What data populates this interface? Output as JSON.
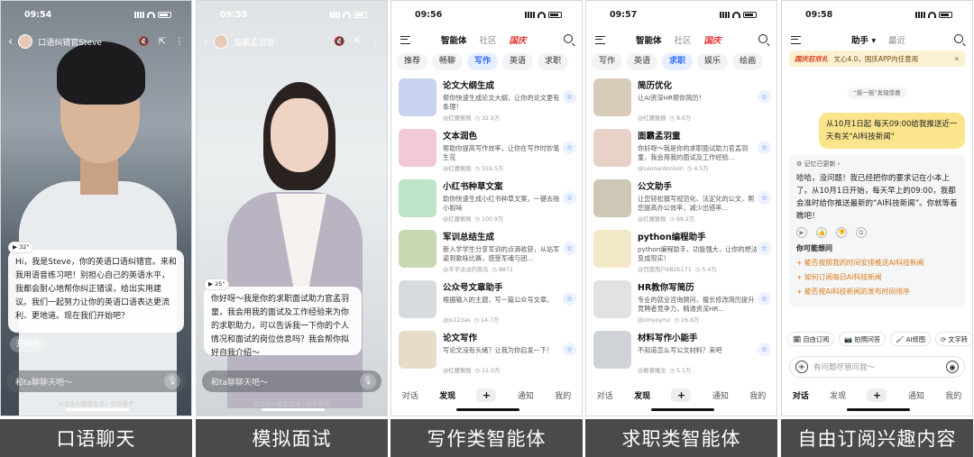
{
  "captions": [
    "口语聊天",
    "模拟面试",
    "写作类智能体",
    "求职类智能体",
    "自由订阅兴趣内容"
  ],
  "screen1": {
    "time": "09:54",
    "title": "口语纠错官Steve",
    "duration": "32\"",
    "message": "Hi，我是Steve，你的英语口语纠错官。来和我用语音练习吧！别担心自己的英语水平，我都会耐心地帮你纠正错误，给出实用建议。我们一起努力让你的英语口语表达更流利、更地道。现在我们开始吧？",
    "start_label": "开始吧",
    "input_placeholder": "和ta聊聊天吧～",
    "footnote": "对话由AI模型生成，仅供参考"
  },
  "screen2": {
    "time": "09:55",
    "title": "面霸孟羽童",
    "duration": "25\"",
    "message": "你好呀～我是你的求职面试助力官孟羽童，我会用我的面试及工作经验来为你的求职助力，可以告诉我一下你的个人情况和面试的岗位信息吗？我会帮你拟好自我介绍～",
    "input_placeholder": "和ta聊聊天吧～",
    "footnote": "对话由AI模型生成，仅供参考"
  },
  "screen3": {
    "time": "09:56",
    "nav_tabs": [
      "智能体",
      "社区",
      "国庆"
    ],
    "categories": [
      "推荐",
      "畅聊",
      "写作",
      "英语",
      "求职"
    ],
    "active_category": "写作",
    "agents": [
      {
        "name": "论文大纲生成",
        "desc": "帮你快速生成论文大纲，让你的论文更有条理！",
        "author": "@红魔猴猴",
        "count": "32.9万",
        "color": "#c7d3ef"
      },
      {
        "name": "文本润色",
        "desc": "帮助你提高写作效率，让你在写作时妙笔生花",
        "author": "@红魔猴猴",
        "count": "559.5万",
        "color": "#f2c9d9"
      },
      {
        "name": "小红书种草文案",
        "desc": "助你快速生成小红书种草文案，一键去除小姐味",
        "author": "@红魔猴猴",
        "count": "100.9万",
        "color": "#bfe3c6"
      },
      {
        "name": "军训总结生成",
        "desc": "新入学学生分享军训的点滴收获，从站军姿到歌咏比赛，感受军魂与团...",
        "author": "@平平淡淡的南瓜",
        "count": "8872",
        "color": "#c9d8b0"
      },
      {
        "name": "公众号文章助手",
        "desc": "根据输入的主题，写一篇公众号文章。",
        "author": "@js123as",
        "count": "14.7万",
        "color": "#d7dadf"
      },
      {
        "name": "论文写作",
        "desc": "写论文没有头绪？让我为你启发一下！",
        "author": "@红魔猴猴",
        "count": "11.0万",
        "color": "#e6dcc9"
      }
    ],
    "bottom_nav": [
      "对话",
      "发现",
      "+",
      "通知",
      "我的"
    ]
  },
  "screen4": {
    "time": "09:57",
    "nav_tabs": [
      "智能体",
      "社区",
      "国庆"
    ],
    "categories": [
      "写作",
      "英语",
      "求职",
      "娱乐",
      "绘画"
    ],
    "active_category": "求职",
    "agents": [
      {
        "name": "简历优化",
        "desc": "让AI资深HR帮你简历！",
        "author": "@红魔猴猴",
        "count": "8.6万",
        "color": "#d9cbb9"
      },
      {
        "name": "面霸孟羽童",
        "desc": "你好呀～我是你的求职面试助力官孟羽童，我会用我的面试及工作经验...",
        "author": "@Leonardonlxin",
        "count": "4.5万",
        "color": "#e8d2c7"
      },
      {
        "name": "公文助手",
        "desc": "让您轻松撰写规范化、法定化的公文，帮您提高办公效率，减少出错率...",
        "author": "@红魔猴猴",
        "count": "88.2万",
        "color": "#cfc7b6"
      },
      {
        "name": "python编程助手",
        "desc": "python编程助手，功能强大，让你的想法变成现实！",
        "author": "@百度用户bB2b171",
        "count": "5.4万",
        "color": "#f3e9c9"
      },
      {
        "name": "HR教你写简历",
        "desc": "专业的就业咨询顾问，擅长修改简历提升竞聘者竞争力，精通资深HR...",
        "author": "@zmyoymz",
        "count": "26.8万",
        "color": "#e2e2e2"
      },
      {
        "name": "材料写作小能手",
        "desc": "不知道怎么写公文材料？来吧",
        "author": "@靓睿庵文",
        "count": "5.1万",
        "color": "#cfd3d8"
      }
    ],
    "bottom_nav": [
      "对话",
      "发现",
      "+",
      "通知",
      "我的"
    ]
  },
  "screen5": {
    "time": "09:58",
    "nav_tabs": [
      "助手",
      "最近"
    ],
    "banner_tag": "国庆狂欢礼",
    "banner_text": "文心4.0，国庆APP内任意用",
    "hint": "“摇一摇”发现惊喜",
    "user_message": "从10月1日起 每天09:00给我推送近一天有关\"AI科技新闻\"",
    "memory_label": "记忆已更新 ›",
    "reply": "哈哈，没问题！我已经把你的要求记在小本上了。从10月1日开始，每天早上的09:00，我都会准时给你推送最新的“AI科技新闻”。你就等着瞧吧！",
    "you_may_title": "你可能想问",
    "suggestions": [
      "+ 能否按照我的时间安排推送AI科技新闻",
      "+ 如何订阅每日AI科技新闻",
      "+ 能否按AI科技新闻的发布时间排序"
    ],
    "tools": [
      "自由订阅",
      "拍照问答",
      "AI修图",
      "文字转"
    ],
    "input_placeholder": "有问题尽管问我～",
    "bottom_nav": [
      "对话",
      "发现",
      "+",
      "通知",
      "我的"
    ]
  }
}
